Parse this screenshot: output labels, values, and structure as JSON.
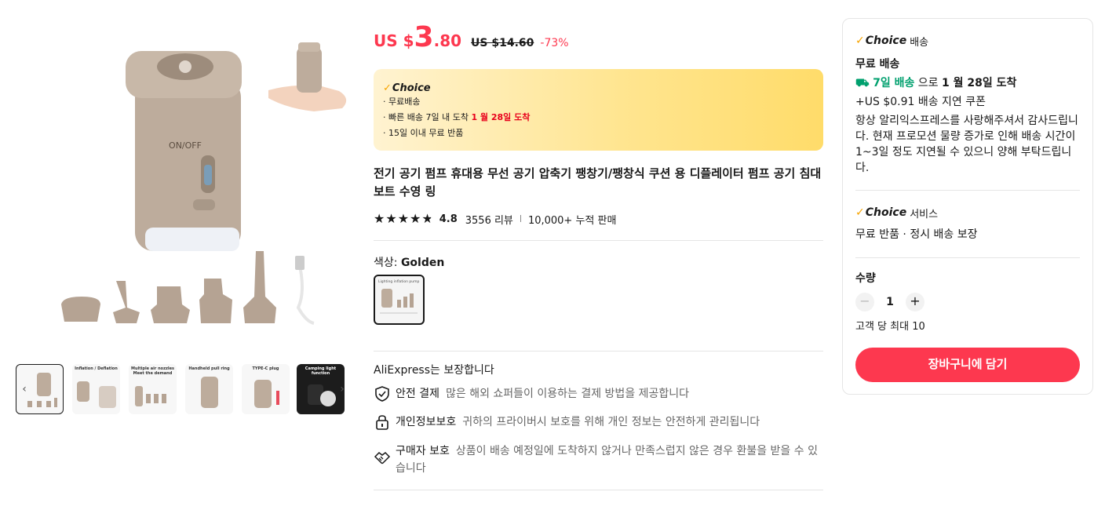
{
  "gallery": {
    "main_image": {
      "text": "ON/OFF"
    },
    "thumbnails": [
      {
        "caption": ""
      },
      {
        "caption": "Inflation / Deflation"
      },
      {
        "caption": "Multiple air nozzles Meet the demand"
      },
      {
        "caption": "Handheld pull ring"
      },
      {
        "caption": "TYPE-C plug"
      },
      {
        "caption": "Camping light function"
      }
    ],
    "prev_icon": "chevron-left-icon",
    "next_icon": "chevron-right-icon"
  },
  "product": {
    "price": {
      "currency": "US $",
      "integer": "3",
      "decimal": ".80",
      "original": "US $14.60",
      "discount": "-73%"
    },
    "choice_box": {
      "logo": "Choice",
      "line1": "· 무료배송",
      "line2_prefix": "· 빠른 배송 7일 내 도착 ",
      "line2_date": "1 월 28일 도착",
      "line3_prefix": "· 15일 이내 ",
      "line3_rest": " 무료 반품"
    },
    "title": "전기 공기 펌프 휴대용 무선 공기 압축기 팽창기/팽창식 쿠션 용 디플레이터 펌프 공기 침대 보트 수영 링",
    "rating": {
      "stars": 4.8,
      "score": "4.8",
      "reviews": "3556 리뷰",
      "sep": "|",
      "sold": "10,000+ 누적 판매"
    },
    "color": {
      "label": "색상: ",
      "value": "Golden",
      "swatch_caption": "Lighting inflation pump"
    },
    "assurance": {
      "title": "AliExpress는 보장합니다",
      "items": [
        {
          "icon": "shield-check-icon",
          "name": "안전 결제",
          "desc": "많은 해외 쇼퍼들이 이용하는 결제 방법을 제공합니다"
        },
        {
          "icon": "lock-icon",
          "name": "개인정보보호",
          "desc": "귀하의 프라이버시 보호를 위해 개인 정보는 안전하게 관리됩니다"
        },
        {
          "icon": "handshake-icon",
          "name": "구매자 보호",
          "desc": "상품이 배송 예정일에 도착하지 않거나 만족스럽지 않은 경우 환불을 받을 수 있습니다"
        }
      ]
    }
  },
  "panel": {
    "shipping": {
      "logo": "Choice",
      "title_suffix": "배송",
      "free": "무료 배송",
      "eta_icon": "truck-icon",
      "eta_fast": "7일 배송",
      "eta_mid": " 으로 ",
      "eta_date": "1 월 28일 도착",
      "coupon": "+US $0.91 배송 지연 쿠폰",
      "notice": "항상 알리익스프레스를 사랑해주셔서 감사드립니다. 현재 프로모션 물량 증가로 인해 배송 시간이 1~3일 정도 지연될 수 있으니 양해 부탁드립니다."
    },
    "service": {
      "logo": "Choice",
      "title_suffix": "서비스",
      "text": "무료 반품 · 정시 배송 보장"
    },
    "quantity": {
      "label": "수량",
      "value": "1",
      "minus": "−",
      "plus": "+",
      "limit": "고객 당 최대 10"
    },
    "cart_button": "장바구니에 담기"
  },
  "colors": {
    "accent": "#fd384f",
    "green": "#00a06e",
    "choice_orange": "#f7a400",
    "product_beige": "#b9a898"
  }
}
